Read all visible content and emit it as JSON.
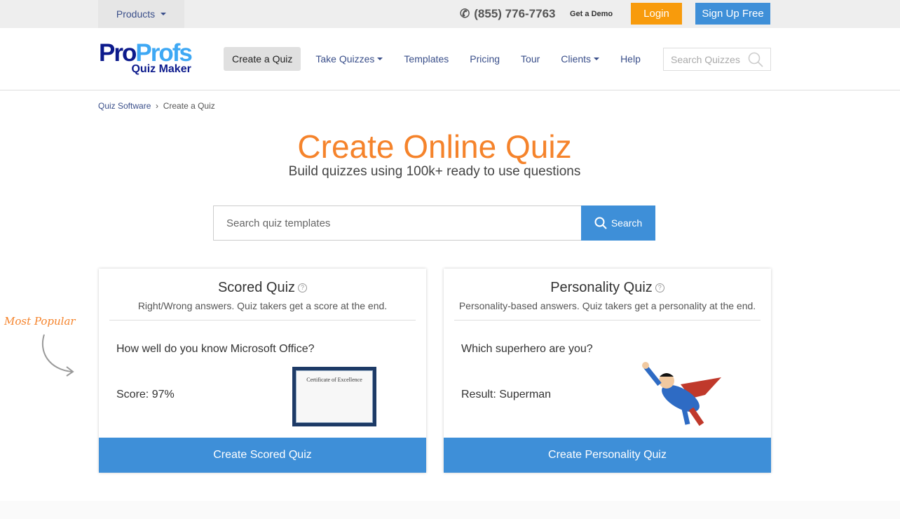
{
  "topbar": {
    "products": "Products",
    "phone": "(855) 776-7763",
    "demo": "Get a Demo",
    "login": "Login",
    "signup": "Sign Up Free"
  },
  "logo": {
    "pro": "Pro",
    "profs": "Profs",
    "sub": "Quiz Maker"
  },
  "nav": {
    "items": [
      "Create a Quiz",
      "Take Quizzes",
      "Templates",
      "Pricing",
      "Tour",
      "Clients",
      "Help"
    ],
    "search_placeholder": "Search Quizzes"
  },
  "breadcrumb": {
    "parent": "Quiz Software",
    "sep": "›",
    "current": "Create a Quiz"
  },
  "hero": {
    "title": "Create Online Quiz",
    "subtitle": "Build quizzes using 100k+ ready to use questions",
    "search_placeholder": "Search quiz templates",
    "search_button": "Search"
  },
  "most_popular": "Most Popular",
  "cards": [
    {
      "title": "Scored Quiz",
      "desc": "Right/Wrong answers. Quiz takers get a score at the end.",
      "question": "How well do you know Microsoft Office?",
      "result": "Score: 97%",
      "cta": "Create Scored Quiz",
      "image_text": "Certificate of Excellence"
    },
    {
      "title": "Personality Quiz",
      "desc": "Personality-based answers. Quiz takers get a personality at the end.",
      "question": "Which superhero are you?",
      "result": "Result: Superman",
      "cta": "Create Personality Quiz"
    }
  ],
  "colors": {
    "accent": "#f5832b",
    "primary": "#3e8fd8",
    "login": "#f89b0c"
  }
}
